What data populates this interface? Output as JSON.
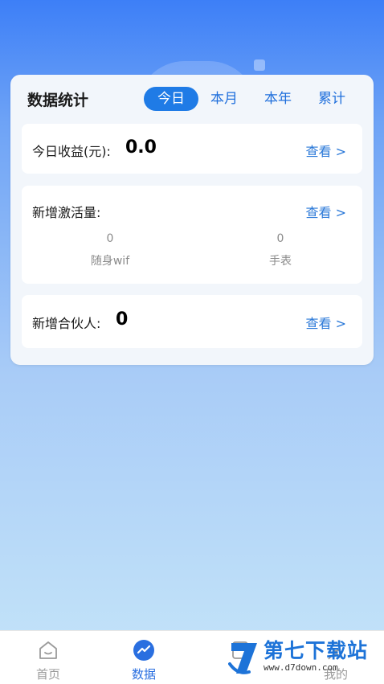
{
  "panel": {
    "title": "数据统计",
    "tabs": [
      "今日",
      "本月",
      "本年",
      "累计"
    ],
    "active_tab": "今日"
  },
  "income": {
    "label": "今日收益(元):",
    "value": "0.0",
    "link": "查看 >"
  },
  "activation": {
    "label": "新增激活量:",
    "link": "查看 >",
    "items": [
      {
        "count": "0",
        "label": "随身wif"
      },
      {
        "count": "0",
        "label": "手表"
      }
    ]
  },
  "partners": {
    "label": "新增合伙人:",
    "value": "0",
    "link": "查看 >"
  },
  "tabbar": {
    "items": [
      {
        "label": "首页",
        "icon": "home-icon"
      },
      {
        "label": "数据",
        "icon": "chart-icon"
      },
      {
        "label": "",
        "icon": "device-icon"
      },
      {
        "label": "我的",
        "icon": "user-icon"
      }
    ],
    "active": "数据"
  },
  "watermark": {
    "main": "第七下载站",
    "url": "www.d7down.com"
  },
  "colors": {
    "accent": "#1f7be6",
    "link": "#2a78d8",
    "brand": "#1d73d8"
  }
}
